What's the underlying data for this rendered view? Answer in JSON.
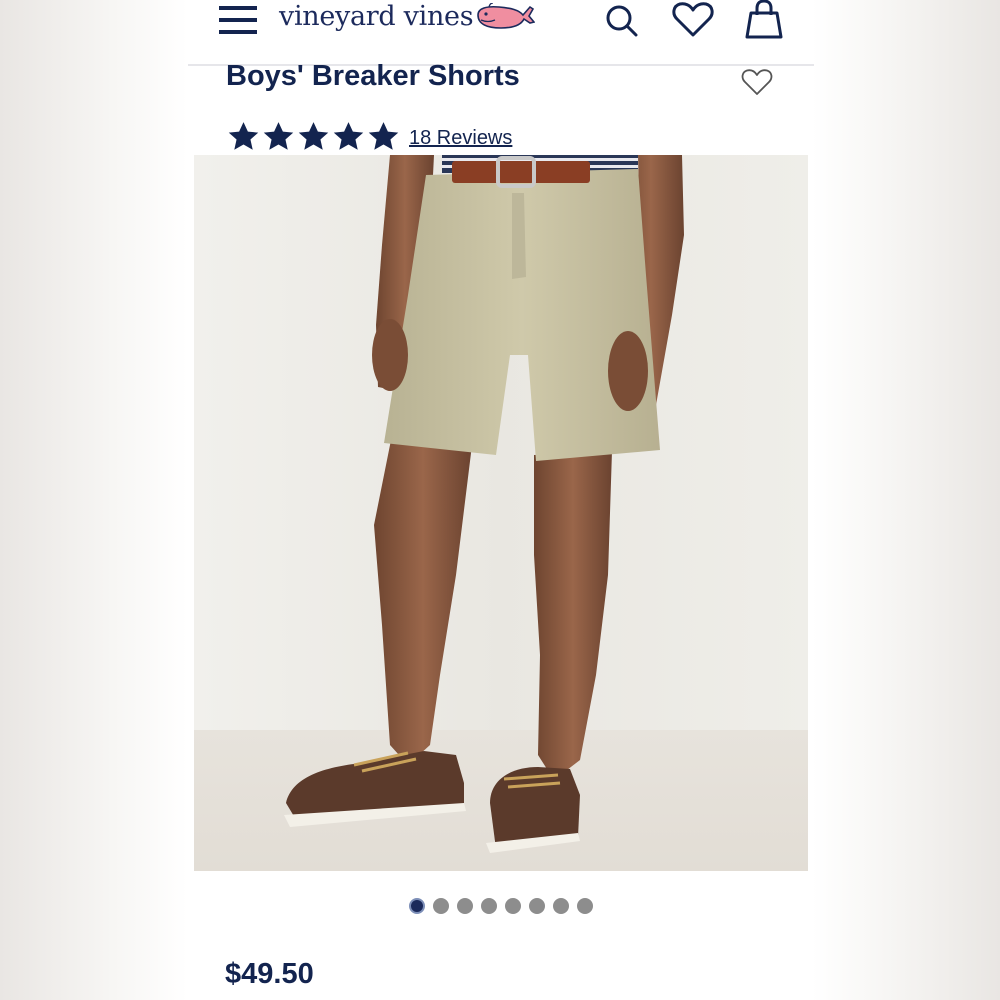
{
  "header": {
    "brand_name": "vineyard vines",
    "logo_icon": "whale-logo-icon",
    "brand_color": "#1c2a5c",
    "whale_color": "#f08ea0"
  },
  "product": {
    "title": "Boys' Breaker Shorts",
    "rating": 5,
    "rating_max": 5,
    "reviews_label": "18 Reviews",
    "price": "$49.50",
    "image_alt": "Product photo: boy wearing khaki shorts, belt and boat shoes"
  },
  "carousel": {
    "total": 8,
    "active_index": 0
  },
  "icons": [
    "menu-icon",
    "whale-logo-icon",
    "search-icon",
    "heart-icon",
    "bag-icon",
    "wishlist-heart-icon",
    "star-icon"
  ]
}
